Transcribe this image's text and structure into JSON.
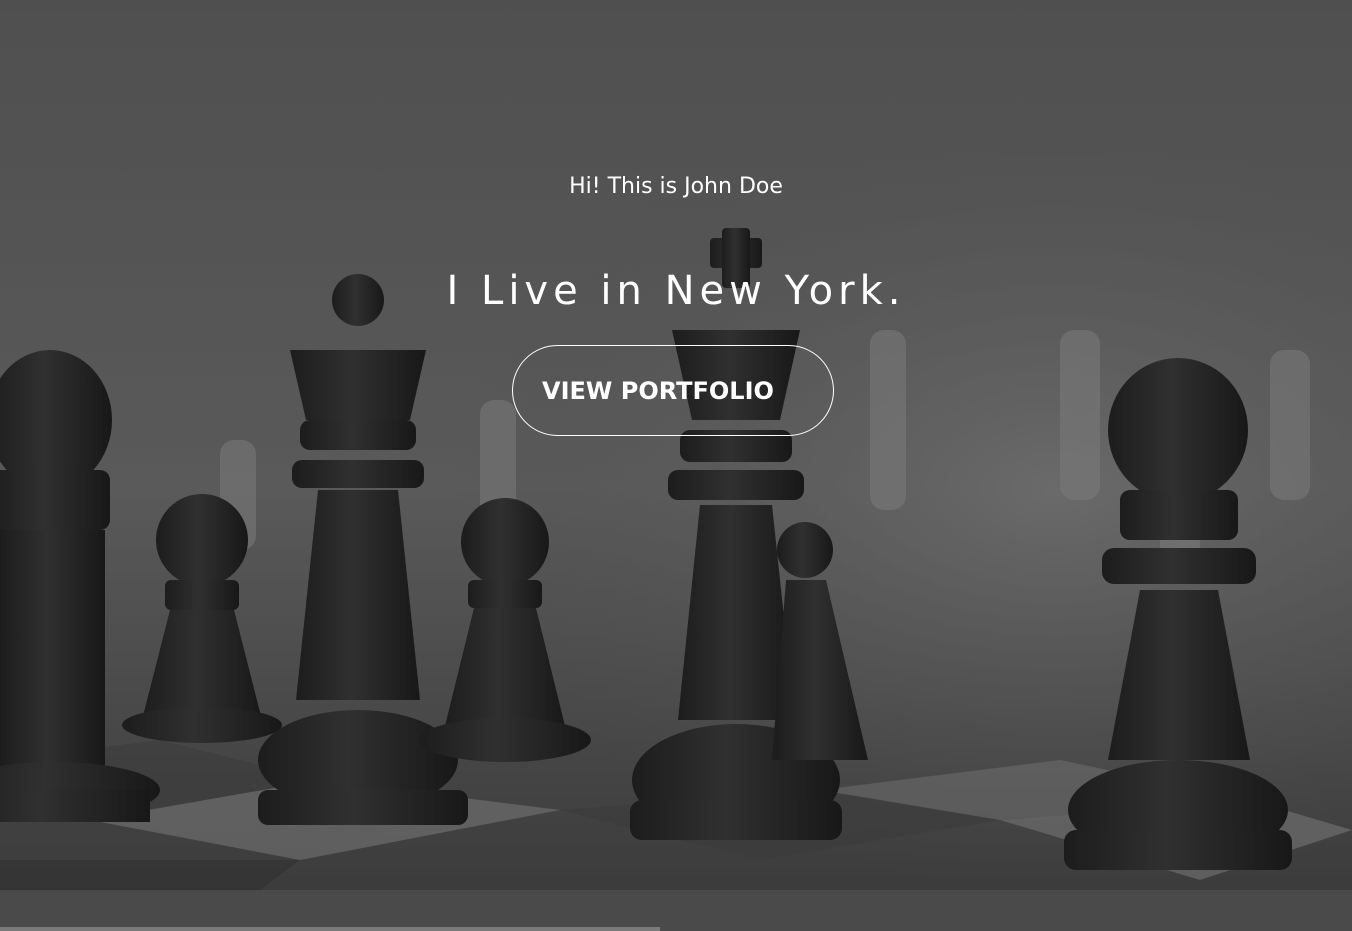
{
  "hero": {
    "greeting": "Hi! This is John Doe",
    "headline": "I Live in New York.",
    "cta_label": "VIEW PORTFOLIO",
    "background_image": "chess-pieces-photo"
  },
  "colors": {
    "overlay": "#4a4a4a",
    "text": "#ffffff",
    "button_border": "#ffffff"
  }
}
